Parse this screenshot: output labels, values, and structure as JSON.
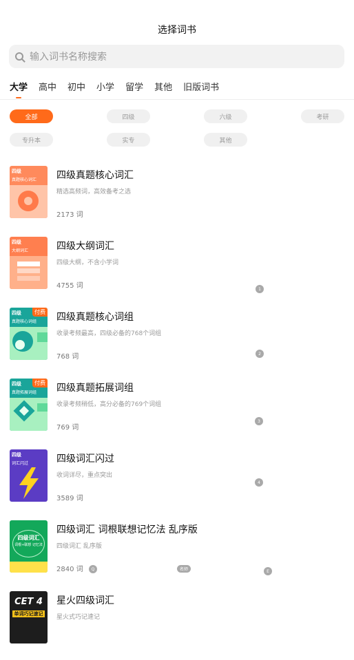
{
  "header": {
    "title": "选择词书"
  },
  "search": {
    "placeholder": "输入词书名称搜索"
  },
  "tabs": [
    "大学",
    "高中",
    "初中",
    "小学",
    "留学",
    "其他",
    "旧版词书"
  ],
  "filters": [
    "全部",
    "四级",
    "六级",
    "考研",
    "专升本",
    "实专",
    "其他"
  ],
  "colors": {
    "accent": "#ff6a1a"
  },
  "books": [
    {
      "name": "四级真题核心词汇",
      "desc": "精选高频词，高效备考之选",
      "count": "2173 词",
      "cover_title": "四级",
      "cover_sub": "真题核心词汇",
      "paid": ""
    },
    {
      "name": "四级大纲词汇",
      "desc": "四级大纲，不含小学词",
      "count": "4755 词",
      "cover_title": "四级",
      "cover_sub": "大纲词汇",
      "paid": ""
    },
    {
      "name": "四级真题核心词组",
      "desc": "收录考频最高，四级必备的768个词组",
      "count": "768 词",
      "cover_title": "四级",
      "cover_sub": "真题核心词组",
      "paid": "付费"
    },
    {
      "name": "四级真题拓展词组",
      "desc": "收录考频稍低，高分必备的769个词组",
      "count": "769 词",
      "cover_title": "四级",
      "cover_sub": "真题拓展词组",
      "paid": "付费"
    },
    {
      "name": "四级词汇闪过",
      "desc": "收词详尽，重点突出",
      "count": "3589 词",
      "cover_title": "四级",
      "cover_sub": "词汇闪过",
      "paid": ""
    },
    {
      "name": "四级词汇 词根联想记忆法 乱序版",
      "desc": "四级词汇 乱序版",
      "count": "2840 词",
      "cover_title": "四级词汇",
      "cover_sub": "词根+联想 记忆法",
      "paid": ""
    },
    {
      "name": "星火四级词汇",
      "desc": "星火式巧记速记",
      "count": "",
      "cover_title": "CET 4",
      "cover_sub": "单词巧记速记",
      "paid": ""
    }
  ],
  "badges": {
    "b1": "1",
    "b2": "2",
    "b3": "3",
    "b4": "4",
    "q": "Q",
    "mid": "名师",
    "e": "E"
  }
}
